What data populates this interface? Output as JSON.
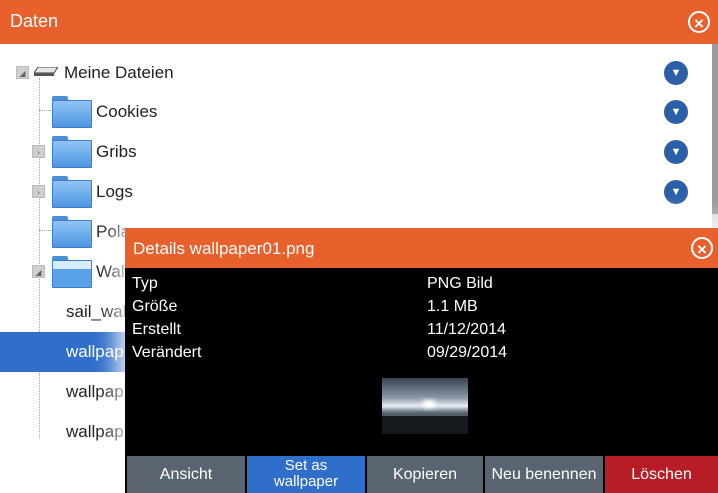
{
  "window": {
    "title": "Daten",
    "close_icon": "×"
  },
  "tree": {
    "root": {
      "label": "Meine Dateien",
      "icon": "drive-icon"
    },
    "items": [
      {
        "label": "Cookies",
        "expandable": false
      },
      {
        "label": "Gribs",
        "expandable": true
      },
      {
        "label": "Logs",
        "expandable": true
      },
      {
        "label": "Pola",
        "expandable": false
      },
      {
        "label": "Wall",
        "expandable": true,
        "expanded": true
      }
    ],
    "files": [
      {
        "label": "sail_wal",
        "selected": false
      },
      {
        "label": "wallpap",
        "selected": true
      },
      {
        "label": "wallpap",
        "selected": false
      },
      {
        "label": "wallpap",
        "selected": false
      }
    ]
  },
  "details": {
    "title": "Details wallpaper01.png",
    "rows": [
      {
        "key": "Typ",
        "value": "PNG Bild"
      },
      {
        "key": "Größe",
        "value": "1.1 MB"
      },
      {
        "key": "Erstellt",
        "value": "11/12/2014"
      },
      {
        "key": "Verändert",
        "value": "09/29/2014"
      }
    ],
    "buttons": {
      "view": "Ansicht",
      "set_wallpaper_line1": "Set as",
      "set_wallpaper_line2": "wallpaper",
      "copy": "Kopieren",
      "rename": "Neu benennen",
      "delete": "Löschen"
    }
  },
  "colors": {
    "accent": "#e8602c",
    "selection": "#2f6fc9",
    "delete": "#b81c24",
    "button": "#5a6471",
    "dropdown": "#2d5fa8"
  }
}
